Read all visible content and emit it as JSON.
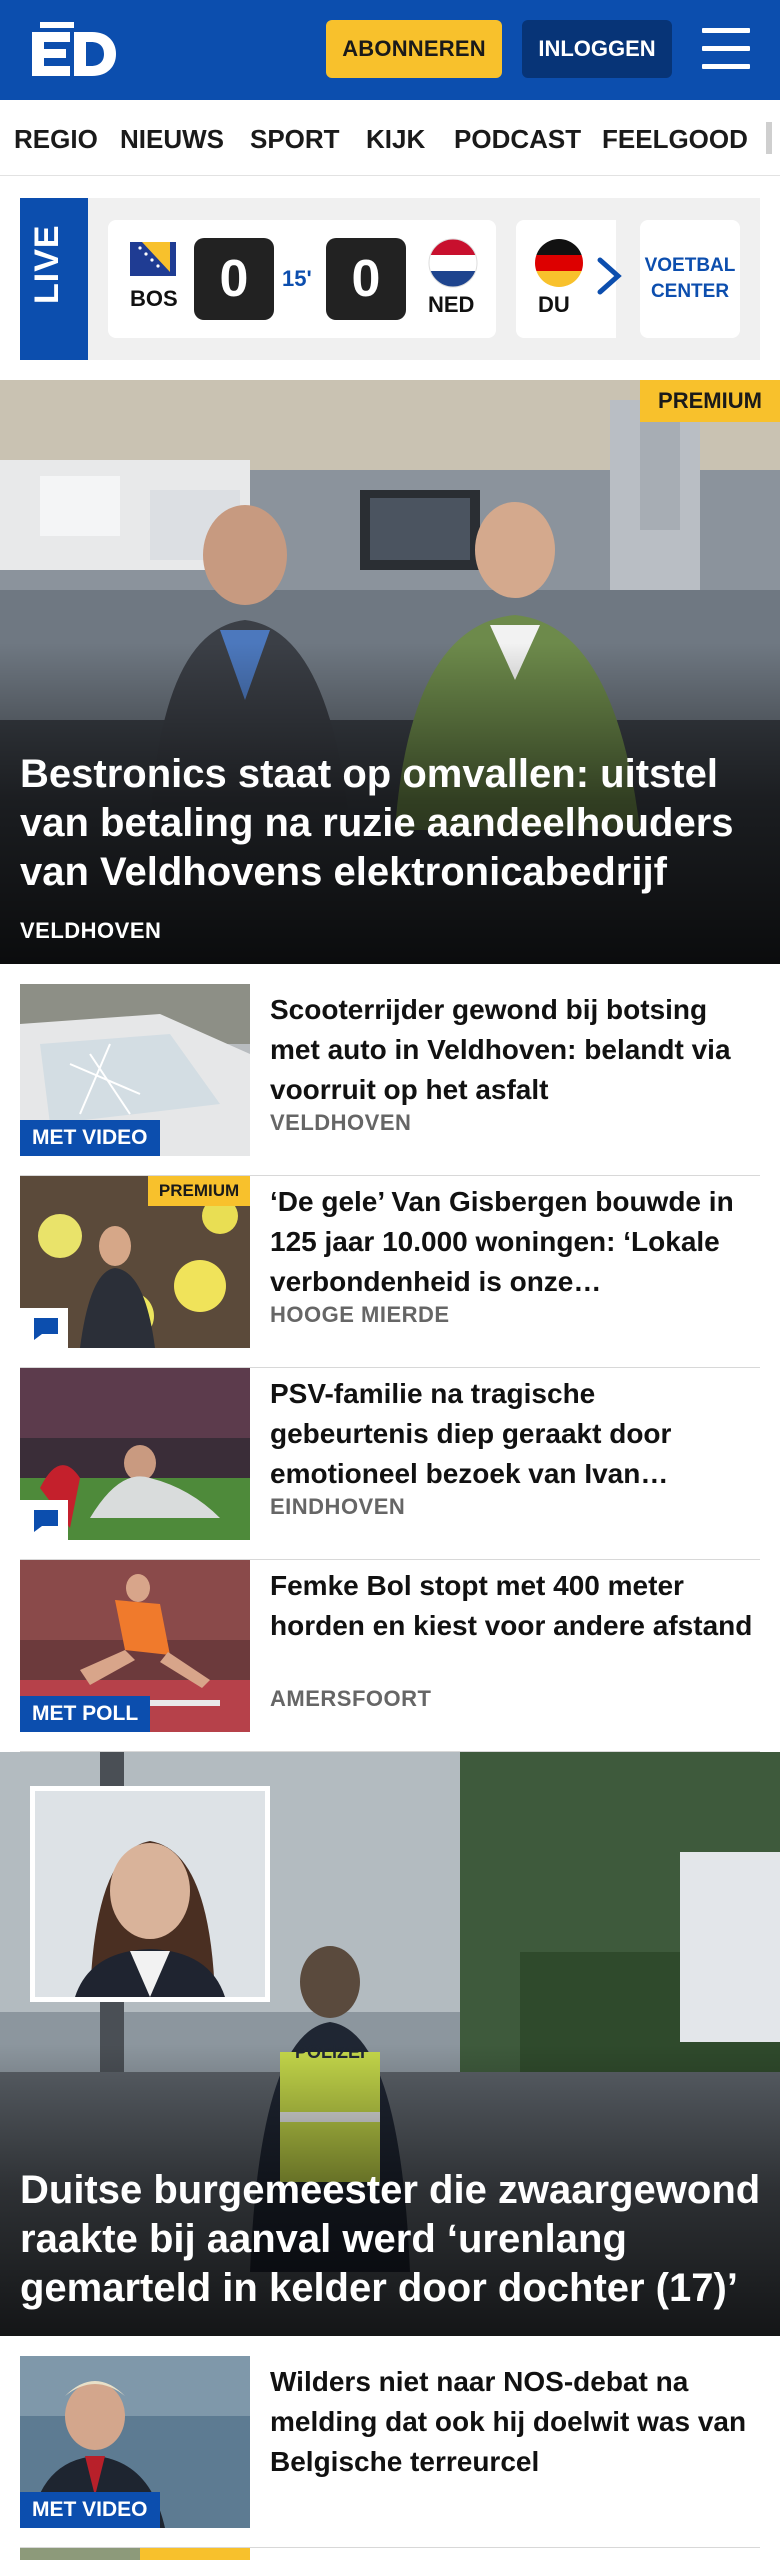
{
  "header": {
    "logo_text": "ED",
    "subscribe_label": "ABONNEREN",
    "login_label": "INLOGGEN",
    "menu_icon": "hamburger-menu-icon",
    "brand_color": "#0c4eae",
    "accent_color": "#f8c12c"
  },
  "nav": {
    "items": [
      "REGIO",
      "NIEUWS",
      "SPORT",
      "KIJK",
      "PODCAST",
      "FEELGOOD"
    ]
  },
  "live": {
    "label": "LIVE",
    "match": {
      "home_code": "BOS",
      "home_score": "0",
      "minute": "15'",
      "away_score": "0",
      "away_code": "NED"
    },
    "next_match_code": "DU",
    "voetbal_center_line1": "VOETBAL",
    "voetbal_center_line2": "CENTER"
  },
  "hero": {
    "premium_label": "PREMIUM",
    "title": "Bestronics staat op omvallen: uitstel van betaling na ruzie aandeelhouders van Veldhovens elektronicabedrijf",
    "location": "VELDHOVEN"
  },
  "articles": [
    {
      "title": "Scooterrijder gewond bij botsing met auto in Veldhoven: belandt via voorruit op het asfalt",
      "location": "VELDHOVEN",
      "tag": "MET VIDEO"
    },
    {
      "title": "‘De gele’ Van Gisbergen bouwde in 125 jaar 10.000 woningen: ‘Lokale verbondenheid is onze…",
      "location": "HOOGE MIERDE",
      "premium_label": "PREMIUM"
    },
    {
      "title": "PSV-familie na tragische gebeurtenis diep geraakt door emotioneel bezoek van Ivan…",
      "location": "EINDHOVEN"
    },
    {
      "title": "Femke Bol stopt met 400 meter horden en kiest voor andere afstand",
      "location": "AMERSFOORT",
      "tag": "MET POLL"
    }
  ],
  "feature": {
    "title": "Duitse burgemeester die zwaargewond raakte bij aanval werd ‘urenlang gemarteld in kelder door dochter (17)’",
    "vest_text": "POLIZEI"
  },
  "bottom_articles": [
    {
      "title": "Wilders niet naar NOS-debat na melding dat ook hij doelwit was van Belgische terreurcel",
      "tag": "MET VIDEO"
    },
    {
      "premium_label": "PREMIUM"
    }
  ]
}
